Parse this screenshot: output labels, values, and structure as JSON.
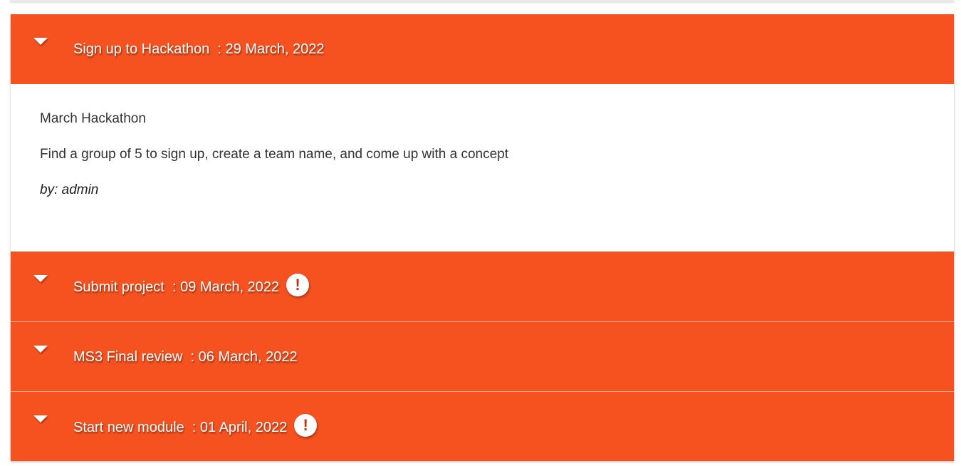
{
  "colors": {
    "accent": "#f55220",
    "alert_icon": "#c0330f"
  },
  "events": [
    {
      "title": "Sign up to Hackathon",
      "date": "29 March, 2022",
      "expanded": true,
      "has_alert": false,
      "body": {
        "name": "March Hackathon",
        "description": "Find a group of 5 to sign up, create a team name, and come up with a concept",
        "author": "by: admin"
      }
    },
    {
      "title": "Submit project",
      "date": "09 March, 2022",
      "expanded": false,
      "has_alert": true,
      "alert_icon": "exclamation-icon"
    },
    {
      "title": "MS3 Final review",
      "date": "06 March, 2022",
      "expanded": false,
      "has_alert": false
    },
    {
      "title": "Start new module",
      "date": "01 April, 2022",
      "expanded": false,
      "has_alert": true,
      "alert_icon": "exclamation-icon"
    }
  ]
}
